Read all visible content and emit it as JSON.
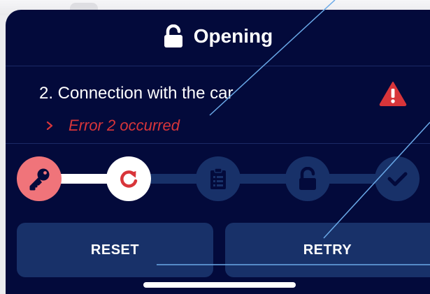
{
  "header": {
    "title": "Opening",
    "icon": "lock-open-icon"
  },
  "step": {
    "title": "2. Connection with the car",
    "status_icon": "warning-icon",
    "error_marker_icon": "chevron-right-icon",
    "error_message": "Error 2 occurred"
  },
  "progress": {
    "current_step": 2,
    "total_steps": 5,
    "nodes": [
      {
        "icon": "key-icon",
        "state": "done"
      },
      {
        "icon": "retry-icon",
        "state": "current"
      },
      {
        "icon": "clipboard-icon",
        "state": "pending"
      },
      {
        "icon": "unlock-icon",
        "state": "pending"
      },
      {
        "icon": "check-icon",
        "state": "pending"
      }
    ]
  },
  "actions": {
    "reset_label": "RESET",
    "retry_label": "RETRY"
  },
  "colors": {
    "background": "#030a3b",
    "surface": "#183169",
    "accent_error": "#d8353a",
    "accent_done": "#f0747a",
    "text": "#ffffff"
  }
}
